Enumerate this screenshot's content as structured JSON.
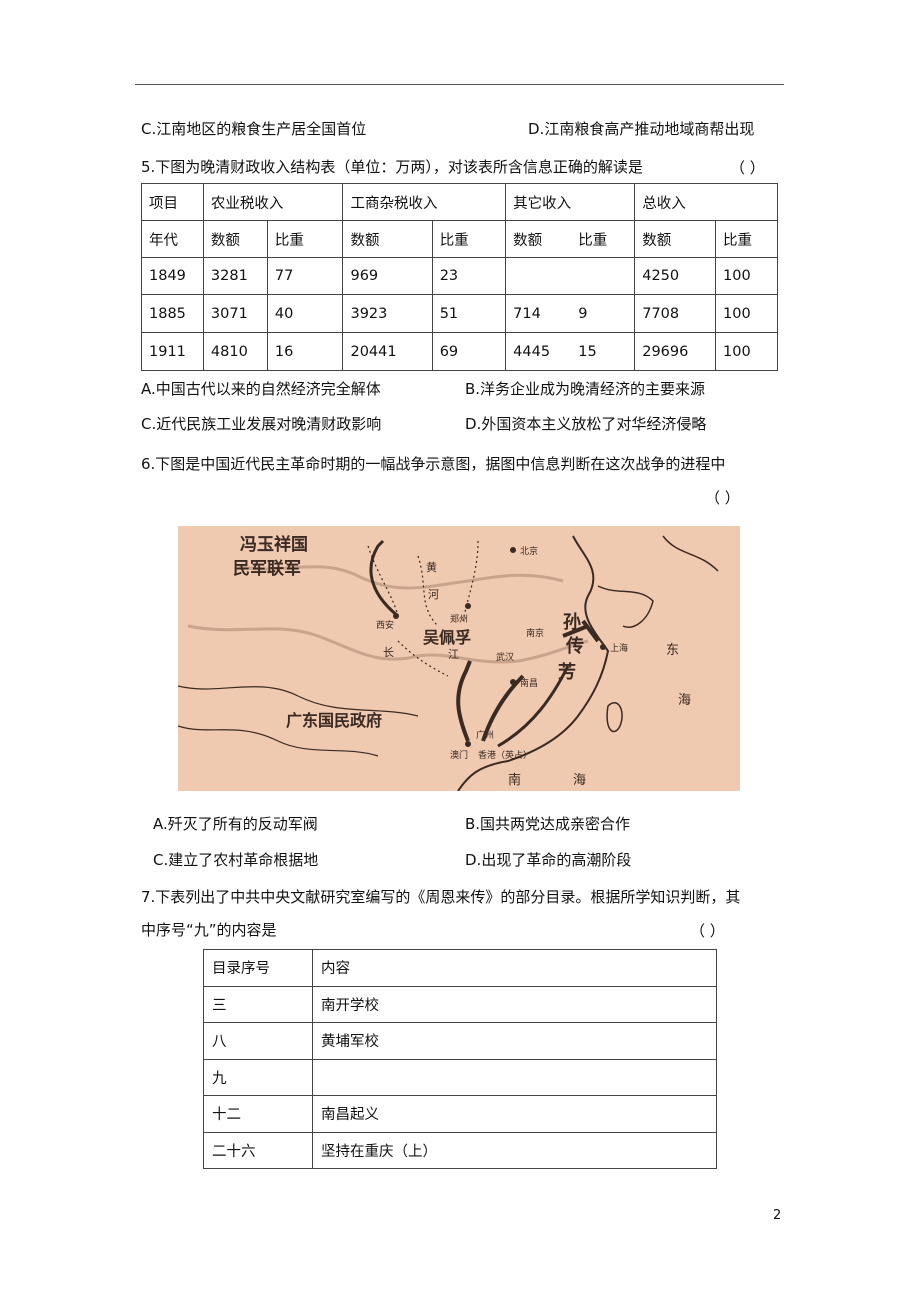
{
  "q4_options": {
    "c": "C.江南地区的粮食生产居全国首位",
    "d": "D.江南粮食高产推动地域商帮出现"
  },
  "q5": {
    "stem": "5.下图为晚清财政收入结构表（单位：万两），对该表所含信息正确的解读是",
    "paren": "（ ）",
    "table": {
      "header1": [
        "项目",
        "农业税收入",
        "工商杂税收入",
        "其它收入",
        "总收入"
      ],
      "header2": [
        "年代",
        "数额",
        "比重",
        "数额",
        "比重",
        "数额",
        "比重",
        "数额",
        "比重"
      ],
      "rows": [
        [
          "1849",
          "3281",
          "77",
          "969",
          "23",
          "",
          "",
          "4250",
          "100"
        ],
        [
          "1885",
          "3071",
          "40",
          "3923",
          "51",
          "714",
          "9",
          "7708",
          "100"
        ],
        [
          "1911",
          "4810",
          "16",
          "20441",
          "69",
          "4445",
          "15",
          "29696",
          "100"
        ]
      ]
    },
    "options": {
      "a": "A.中国古代以来的自然经济完全解体",
      "b": "B.洋务企业成为晚清经济的主要来源",
      "c": "C.近代民族工业发展对晚清财政影响",
      "d": "D.外国资本主义放松了对华经济侵略"
    }
  },
  "q6": {
    "stem": "6.下图是中国近代民主革命时期的一幅战争示意图，据图中信息判断在这次战争的进程中",
    "paren": "（ ）",
    "map_labels": {
      "feng": "冯玉祥国",
      "feng2": "民军联军",
      "beijing": "北京",
      "huang": "黄",
      "he": "河",
      "zhengzhou": "郑州",
      "xian": "西安",
      "wu": "吴佩孚",
      "nanjing": "南京",
      "shanghai": "上海",
      "sun": "孙",
      "chuan": "传",
      "fang": "芳",
      "dong": "东",
      "hai": "海",
      "chang": "长",
      "jiang": "江",
      "wuhan": "武汉",
      "nanchang": "南昌",
      "gd": "广东国民政府",
      "guangzhou": "广州",
      "aomen": "澳门",
      "xianggang": "香港（英占）",
      "nan": "南",
      "nanhai": "海"
    },
    "options": {
      "a": "A.歼灭了所有的反动军阀",
      "b": "B.国共两党达成亲密合作",
      "c": "C.建立了农村革命根据地",
      "d": "D.出现了革命的高潮阶段"
    }
  },
  "q7": {
    "stem1": "7.下表列出了中共中央文献研究室编写的《周恩来传》的部分目录。根据所学知识判断，其",
    "stem2": "中序号“九”的内容是",
    "paren": "（ ）",
    "table": {
      "header": [
        "目录序号",
        "内容"
      ],
      "rows": [
        [
          "三",
          "南开学校"
        ],
        [
          "八",
          "黄埔军校"
        ],
        [
          "九",
          ""
        ],
        [
          "十二",
          "南昌起义"
        ],
        [
          "二十六",
          "坚持在重庆（上）"
        ]
      ]
    }
  },
  "page_number": "2",
  "colors": {
    "map_bg": "#efc9b0",
    "map_ink": "#3a2a22",
    "map_river": "#caa38c"
  }
}
